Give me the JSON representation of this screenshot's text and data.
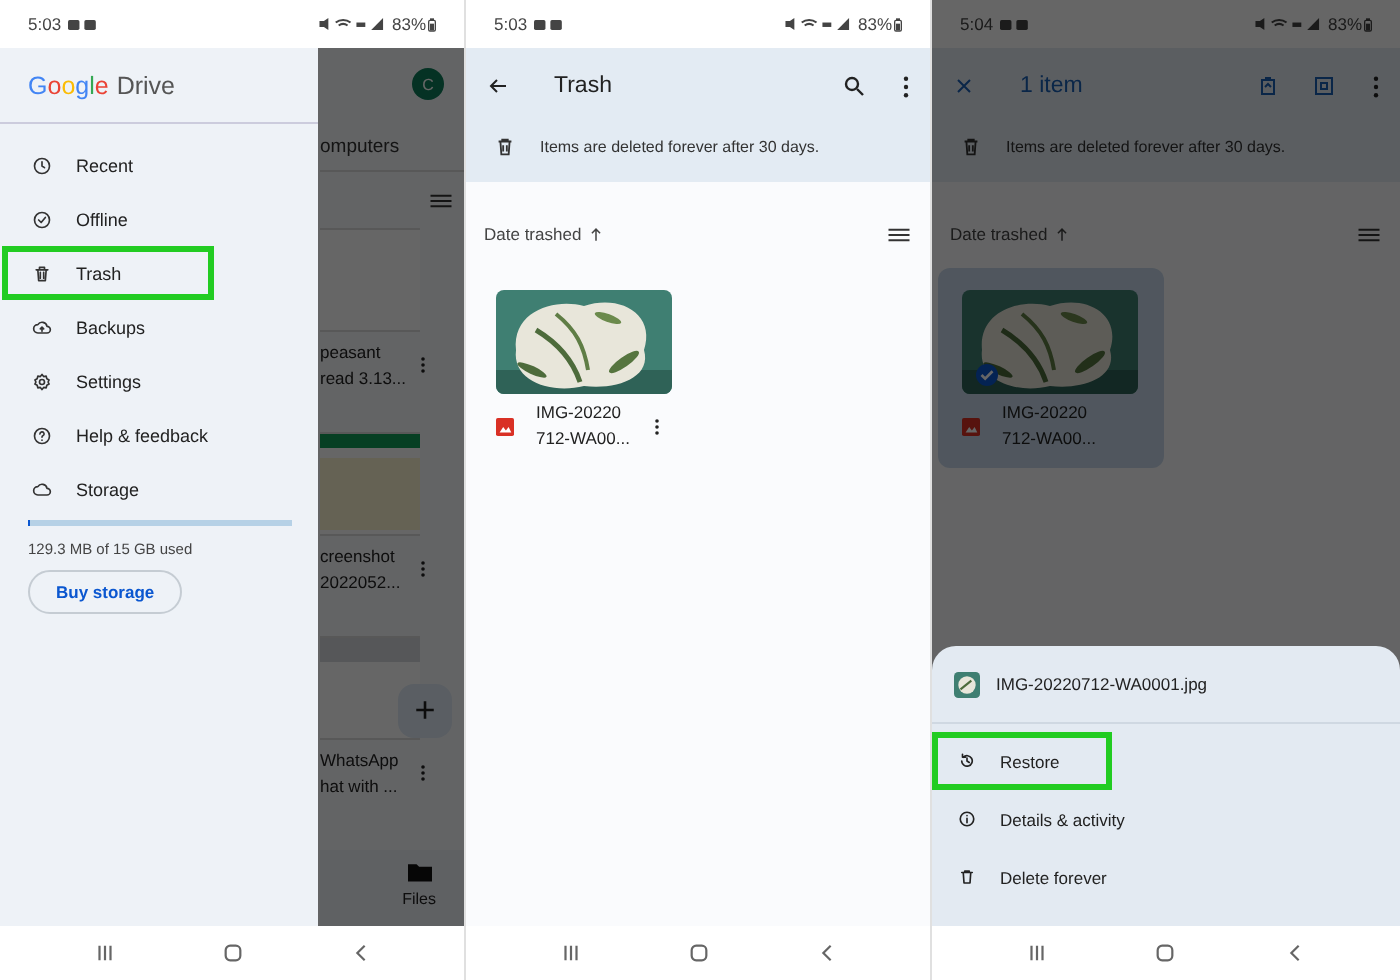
{
  "screens": [
    {
      "kind": "drawer",
      "status": {
        "time": "5:03",
        "battery": "83%"
      },
      "background": {
        "avatar": "C",
        "tab": "omputers",
        "files": [
          {
            "line1": "peasant",
            "line2": "read 3.13..."
          },
          {
            "line1": "creenshot",
            "line2": "2022052..."
          },
          {
            "line1": "WhatsApp",
            "line2": "hat with ..."
          }
        ],
        "fab": "+",
        "nav_label": "Files"
      },
      "drawer": {
        "logo": [
          {
            "letter": "G",
            "color": "#4285f4"
          },
          {
            "letter": "o",
            "color": "#ea4335"
          },
          {
            "letter": "o",
            "color": "#fbbc05"
          },
          {
            "letter": "g",
            "color": "#4285f4"
          },
          {
            "letter": "l",
            "color": "#34a853"
          },
          {
            "letter": "e",
            "color": "#ea4335"
          }
        ],
        "product": "Drive",
        "items": [
          {
            "label": "Recent",
            "kind": "clock",
            "highlighted": false
          },
          {
            "label": "Offline",
            "kind": "offline",
            "highlighted": false
          },
          {
            "label": "Trash",
            "kind": "trash",
            "highlighted": true
          },
          {
            "label": "Backups",
            "kind": "backup",
            "highlighted": false
          },
          {
            "label": "Settings",
            "kind": "settings",
            "highlighted": false
          },
          {
            "label": "Help & feedback",
            "kind": "help",
            "highlighted": false
          },
          {
            "label": "Storage",
            "kind": "storage",
            "highlighted": false
          }
        ],
        "storage": {
          "text": "129.3 MB of 15 GB used",
          "level": 0.01
        },
        "button": "Buy storage"
      }
    },
    {
      "kind": "trash",
      "status": {
        "time": "5:03",
        "battery": "83%"
      },
      "title": "Trash",
      "notice": "Items are deleted forever after 30 days.",
      "sort": "Date trashed",
      "file": {
        "line1": "IMG-20220",
        "line2": "712-WA00...",
        "selected": false
      }
    },
    {
      "kind": "selection",
      "status": {
        "time": "5:04",
        "battery": "83%"
      },
      "title": "1 item",
      "notice": "Items are deleted forever after 30 days.",
      "sort": "Date trashed",
      "file": {
        "line1": "IMG-20220",
        "line2": "712-WA00...",
        "selected": true
      },
      "sheet": {
        "file": "IMG-20220712-WA0001.jpg",
        "actions": [
          {
            "label": "Restore",
            "kind": "restore",
            "highlighted": true
          },
          {
            "label": "Details & activity",
            "kind": "info",
            "highlighted": false
          },
          {
            "label": "Delete forever",
            "kind": "delete",
            "highlighted": false
          }
        ]
      }
    }
  ]
}
